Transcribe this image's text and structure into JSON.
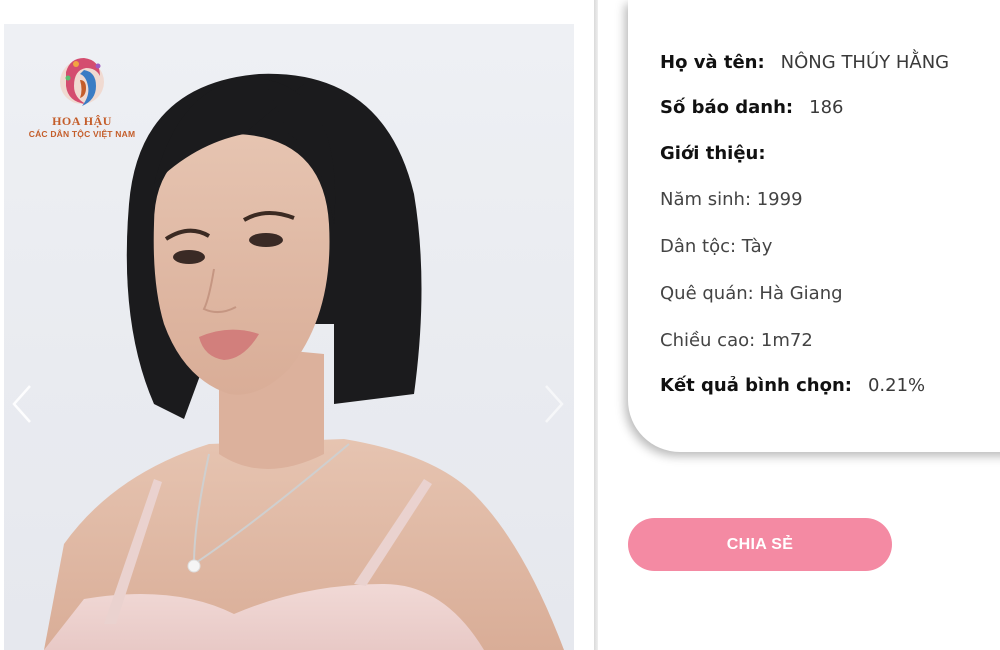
{
  "logo": {
    "title": "HOA HẬU",
    "subtitle": "CÁC DÂN TỘC VIỆT NAM"
  },
  "profile": {
    "name_label": "Họ và tên:",
    "name_value": "NÔNG THÚY HẰNG",
    "number_label": "Số báo danh:",
    "number_value": "186",
    "intro_label": "Giới thiệu:",
    "birth_year": "Năm sinh: 1999",
    "ethnicity": "Dân tộc: Tày",
    "hometown": "Quê quán: Hà Giang",
    "height": "Chiều cao: 1m72",
    "vote_label": "Kết quả bình chọn:",
    "vote_value": "0.21%"
  },
  "share_button": {
    "label": "CHIA SẺ"
  },
  "colors": {
    "accent": "#f48aa3",
    "logo": "#c45d2a"
  }
}
